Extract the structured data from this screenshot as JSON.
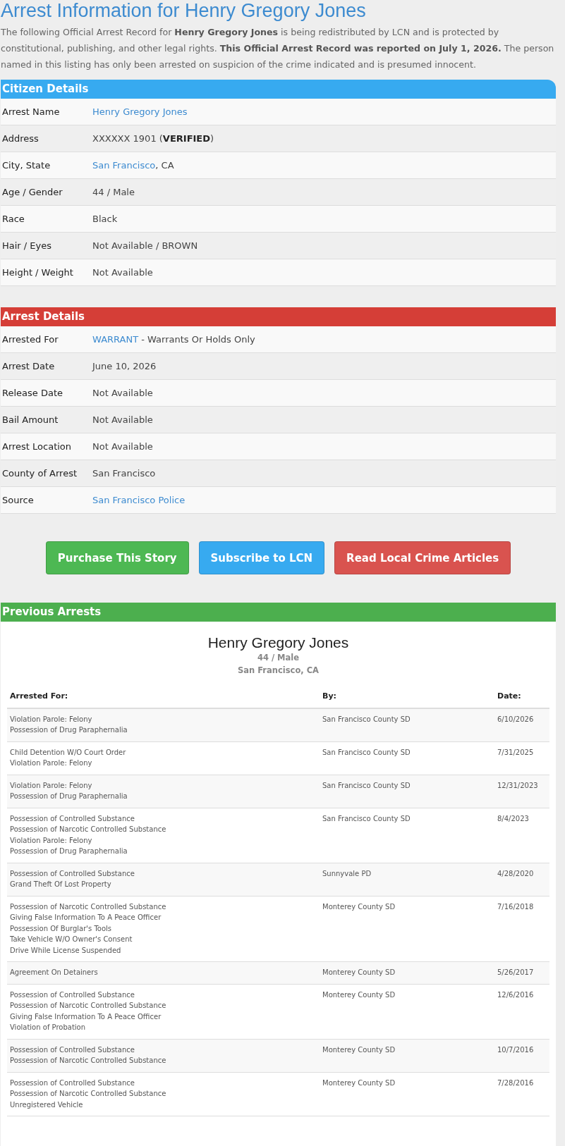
{
  "title": "Arrest Information for Henry Gregory Jones",
  "intro": "The following Official Arrest Record for **Henry Gregory Jones** is being redistributed by LCN and is protected by constitutional, publishing, and other legal rights. **This Official Arrest Record was reported on July 1, 2026.** The person named in this listing has only been arrested on suspicion of the crime indicated and is presumed innocent.",
  "sections": [
    {
      "heading": "Citizen Details",
      "kind": "citizen",
      "rows": [
        {
          "label": "Arrest Name",
          "value": [
            {
              "kind": "link",
              "text": "Henry Gregory Jones"
            }
          ]
        },
        {
          "label": "Address",
          "value": [
            {
              "kind": "text",
              "text": "XXXXXX 1901 (**VERIFIED**)"
            }
          ]
        },
        {
          "label": "City, State",
          "value": [
            {
              "kind": "link",
              "text": "San Francisco"
            },
            {
              "kind": "text",
              "text": ", CA"
            }
          ]
        },
        {
          "label": "Age / Gender",
          "value": [
            {
              "kind": "text",
              "text": "44 / Male"
            }
          ]
        },
        {
          "label": "Race",
          "value": [
            {
              "kind": "text",
              "text": "Black"
            }
          ]
        },
        {
          "label": "Hair / Eyes",
          "value": [
            {
              "kind": "text",
              "text": "Not Available / BROWN"
            }
          ]
        },
        {
          "label": "Height / Weight",
          "value": [
            {
              "kind": "text",
              "text": "Not Available"
            }
          ]
        }
      ]
    },
    {
      "heading": "Arrest Details",
      "kind": "arrest",
      "rows": [
        {
          "label": "Arrested For",
          "value": [
            {
              "kind": "link",
              "text": "WARRANT"
            },
            {
              "kind": "text",
              "text": " - Warrants Or Holds Only"
            }
          ]
        },
        {
          "label": "Arrest Date",
          "value": [
            {
              "kind": "text",
              "text": "June 10, 2026"
            }
          ]
        },
        {
          "label": "Release Date",
          "value": [
            {
              "kind": "text",
              "text": "Not Available"
            }
          ]
        },
        {
          "label": "Bail Amount",
          "value": [
            {
              "kind": "text",
              "text": "Not Available"
            }
          ]
        },
        {
          "label": "Arrest Location",
          "value": [
            {
              "kind": "text",
              "text": "Not Available"
            }
          ]
        },
        {
          "label": "County of Arrest",
          "value": [
            {
              "kind": "text",
              "text": "San Francisco"
            }
          ]
        },
        {
          "label": "Source",
          "value": [
            {
              "kind": "link",
              "text": "San Francisco Police"
            }
          ]
        }
      ]
    }
  ],
  "buttons": [
    {
      "label": "Purchase This Story",
      "kind": "success"
    },
    {
      "label": "Subscribe to LCN",
      "kind": "info"
    },
    {
      "label": "Read Local Crime Articles",
      "kind": "danger"
    }
  ],
  "previous_arrests": {
    "heading": "Previous Arrests",
    "name": "Henry Gregory Jones",
    "age_gender": "44 / Male",
    "location": "San Francisco, CA",
    "columns": [
      "Arrested For:",
      "By:",
      "Date:"
    ],
    "rows": [
      {
        "charges": [
          "Violation Parole: Felony",
          "Possession of Drug Paraphernalia"
        ],
        "by": "San Francisco County SD",
        "date": "6/10/2026"
      },
      {
        "charges": [
          "Child Detention W/O Court Order",
          "Violation Parole: Felony"
        ],
        "by": "San Francisco County SD",
        "date": "7/31/2025"
      },
      {
        "charges": [
          "Violation Parole: Felony",
          "Possession of Drug Paraphernalia"
        ],
        "by": "San Francisco County SD",
        "date": "12/31/2023"
      },
      {
        "charges": [
          "Possession of Controlled Substance",
          "Possession of Narcotic Controlled Substance",
          "Violation Parole: Felony",
          "Possession of Drug Paraphernalia"
        ],
        "by": "San Francisco County SD",
        "date": "8/4/2023"
      },
      {
        "charges": [
          "Possession of Controlled Substance",
          "Grand Theft Of Lost Property"
        ],
        "by": "Sunnyvale PD",
        "date": "4/28/2020"
      },
      {
        "charges": [
          "Possession of Narcotic Controlled Substance",
          "Giving False Information To A Peace Officer",
          "Possession Of Burglar's Tools",
          "Take Vehicle W/O Owner's Consent",
          "Drive While License Suspended"
        ],
        "by": "Monterey County SD",
        "date": "7/16/2018"
      },
      {
        "charges": [
          "Agreement On Detainers"
        ],
        "by": "Monterey County SD",
        "date": "5/26/2017"
      },
      {
        "charges": [
          "Possession of Controlled Substance",
          "Possession of Narcotic Controlled Substance",
          "Giving False Information To A Peace Officer",
          "Violation of Probation"
        ],
        "by": "Monterey County SD",
        "date": "12/6/2016"
      },
      {
        "charges": [
          "Possession of Controlled Substance",
          "Possession of Narcotic Controlled Substance"
        ],
        "by": "Monterey County SD",
        "date": "10/7/2016"
      },
      {
        "charges": [
          "Possession of Controlled Substance",
          "Possession of Narcotic Controlled Substance",
          "Unregistered Vehicle"
        ],
        "by": "Monterey County SD",
        "date": "7/28/2016"
      }
    ]
  }
}
